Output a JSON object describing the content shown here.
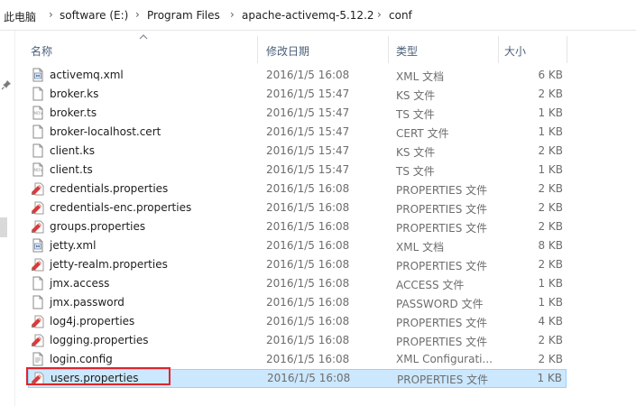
{
  "breadcrumb": [
    "此电脑",
    "software (E:)",
    "Program Files",
    "apache-activemq-5.12.2",
    "conf"
  ],
  "columns": {
    "name": "名称",
    "modified": "修改日期",
    "type": "类型",
    "size": "大小"
  },
  "files": [
    {
      "name": "activemq.xml",
      "modified": "2016/1/5 16:08",
      "type": "XML 文档",
      "size": "6 KB",
      "icon": "xml-file-icon"
    },
    {
      "name": "broker.ks",
      "modified": "2016/1/5 15:47",
      "type": "KS 文件",
      "size": "2 KB",
      "icon": "blank-file-icon"
    },
    {
      "name": "broker.ts",
      "modified": "2016/1/5 15:47",
      "type": "TS 文件",
      "size": "1 KB",
      "icon": "mdv-file-icon"
    },
    {
      "name": "broker-localhost.cert",
      "modified": "2016/1/5 15:47",
      "type": "CERT 文件",
      "size": "1 KB",
      "icon": "blank-file-icon"
    },
    {
      "name": "client.ks",
      "modified": "2016/1/5 15:47",
      "type": "KS 文件",
      "size": "2 KB",
      "icon": "blank-file-icon"
    },
    {
      "name": "client.ts",
      "modified": "2016/1/5 15:47",
      "type": "TS 文件",
      "size": "1 KB",
      "icon": "mdv-file-icon"
    },
    {
      "name": "credentials.properties",
      "modified": "2016/1/5 16:08",
      "type": "PROPERTIES 文件",
      "size": "2 KB",
      "icon": "properties-file-icon"
    },
    {
      "name": "credentials-enc.properties",
      "modified": "2016/1/5 16:08",
      "type": "PROPERTIES 文件",
      "size": "2 KB",
      "icon": "properties-file-icon"
    },
    {
      "name": "groups.properties",
      "modified": "2016/1/5 16:08",
      "type": "PROPERTIES 文件",
      "size": "2 KB",
      "icon": "properties-file-icon"
    },
    {
      "name": "jetty.xml",
      "modified": "2016/1/5 16:08",
      "type": "XML 文档",
      "size": "8 KB",
      "icon": "xml-file-icon"
    },
    {
      "name": "jetty-realm.properties",
      "modified": "2016/1/5 16:08",
      "type": "PROPERTIES 文件",
      "size": "2 KB",
      "icon": "properties-file-icon"
    },
    {
      "name": "jmx.access",
      "modified": "2016/1/5 16:08",
      "type": "ACCESS 文件",
      "size": "1 KB",
      "icon": "blank-file-icon"
    },
    {
      "name": "jmx.password",
      "modified": "2016/1/5 16:08",
      "type": "PASSWORD 文件",
      "size": "1 KB",
      "icon": "blank-file-icon"
    },
    {
      "name": "log4j.properties",
      "modified": "2016/1/5 16:08",
      "type": "PROPERTIES 文件",
      "size": "4 KB",
      "icon": "properties-file-icon"
    },
    {
      "name": "logging.properties",
      "modified": "2016/1/5 16:08",
      "type": "PROPERTIES 文件",
      "size": "2 KB",
      "icon": "properties-file-icon"
    },
    {
      "name": "login.config",
      "modified": "2016/1/5 16:08",
      "type": "XML Configurati...",
      "size": "2 KB",
      "icon": "config-file-icon"
    },
    {
      "name": "users.properties",
      "modified": "2016/1/5 16:08",
      "type": "PROPERTIES 文件",
      "size": "1 KB",
      "icon": "properties-file-icon",
      "selected": true
    }
  ],
  "colors": {
    "selection": "#cce8ff",
    "selection_border": "#99d1ff",
    "highlight": "#e0262a",
    "header_text": "#4c607a"
  }
}
